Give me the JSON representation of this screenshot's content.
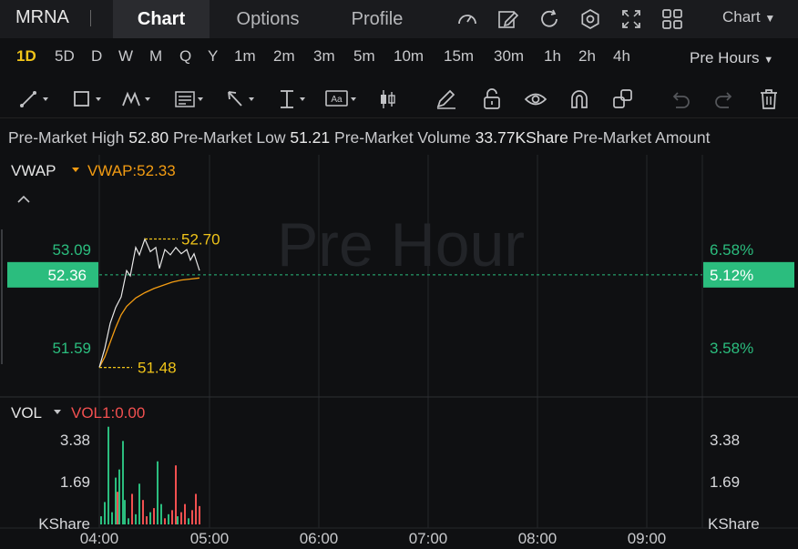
{
  "header": {
    "ticker": "MRNA",
    "tabs": [
      {
        "label": "Chart",
        "active": true
      },
      {
        "label": "Options",
        "active": false
      },
      {
        "label": "Profile",
        "active": false
      }
    ],
    "icons": [
      "gauge-icon",
      "edit-icon",
      "refresh-icon",
      "settings-icon",
      "fullscreen-icon",
      "grid-icon"
    ],
    "chart_dropdown": "Chart"
  },
  "timeframes": {
    "items": [
      "1D",
      "5D",
      "D",
      "W",
      "M",
      "Q",
      "Y",
      "1m",
      "2m",
      "3m",
      "5m",
      "10m",
      "15m",
      "30m",
      "1h",
      "2h",
      "4h"
    ],
    "active": "1D",
    "session": "Pre Hours"
  },
  "toolbar": {
    "tools": [
      "trendline-tool-icon",
      "rectangle-tool-icon",
      "pattern-tool-icon",
      "fib-tool-icon",
      "arrow-tool-icon",
      "measure-tool-icon",
      "text-tool-icon",
      "candle-tool-icon",
      "brush-icon",
      "lock-icon",
      "eye-icon",
      "magnet-icon",
      "layers-icon",
      "undo-icon",
      "redo-icon",
      "trash-icon"
    ]
  },
  "stats": {
    "high_label": "Pre-Market High",
    "high_value": "52.80",
    "low_label": "Pre-Market Low",
    "low_value": "51.21",
    "volume_label": "Pre-Market Volume",
    "volume_value": "33.77KShare",
    "amount_label": "Pre-Market Amount"
  },
  "colors": {
    "accent": "#f0c419",
    "up": "#2bbd7e",
    "down": "#f25050",
    "vwap": "#f39c12"
  },
  "chart_data": {
    "type": "line",
    "watermark": "Pre Hour",
    "indicator_label": "VWAP",
    "indicator_value_label": "VWAP:52.33",
    "price_axis_left": [
      "53.09",
      "52.36",
      "51.59"
    ],
    "price_axis_right": [
      "6.58%",
      "5.12%",
      "3.58%"
    ],
    "current_price": 52.36,
    "current_change": "5.12%",
    "ylim": [
      51.2,
      53.5
    ],
    "x_ticks": [
      "04:00",
      "05:00",
      "06:00",
      "07:00",
      "08:00",
      "09:00"
    ],
    "high_marker": {
      "label": "52.70",
      "value": 52.7
    },
    "low_marker": {
      "label": "51.48",
      "value": 51.48
    },
    "series": [
      {
        "x": [
          0,
          3,
          6,
          9,
          12,
          15,
          17,
          20,
          22,
          25,
          28,
          31,
          33,
          36,
          39,
          42,
          45,
          48,
          50,
          52,
          55
        ],
        "values": [
          51.48,
          51.66,
          51.9,
          52.05,
          52.15,
          52.4,
          52.35,
          52.62,
          52.55,
          52.7,
          52.58,
          52.62,
          52.42,
          52.6,
          52.55,
          52.62,
          52.56,
          52.6,
          52.5,
          52.56,
          52.4
        ]
      },
      {
        "name": "VWAP",
        "x": [
          0,
          3,
          6,
          9,
          12,
          15,
          20,
          25,
          30,
          35,
          40,
          45,
          50,
          55
        ],
        "values": [
          51.48,
          51.58,
          51.72,
          51.86,
          51.98,
          52.06,
          52.14,
          52.19,
          52.23,
          52.26,
          52.29,
          52.31,
          52.32,
          52.33
        ]
      }
    ],
    "volume": {
      "label": "VOL",
      "value_label": "VOL1:0.00",
      "axis_left": [
        "3.38",
        "1.69",
        "KShare"
      ],
      "axis_right": [
        "3.38",
        "1.69",
        "KShare"
      ],
      "ylim": [
        0,
        5.1
      ],
      "bars": [
        {
          "x": 1,
          "v": 0.4,
          "up": true
        },
        {
          "x": 3,
          "v": 1.1,
          "up": true
        },
        {
          "x": 5,
          "v": 4.8,
          "up": true
        },
        {
          "x": 7,
          "v": 0.6,
          "up": true
        },
        {
          "x": 9,
          "v": 2.3,
          "up": true
        },
        {
          "x": 10,
          "v": 1.6,
          "up": false
        },
        {
          "x": 11,
          "v": 2.7,
          "up": true
        },
        {
          "x": 13,
          "v": 4.1,
          "up": true
        },
        {
          "x": 14,
          "v": 1.2,
          "up": true
        },
        {
          "x": 16,
          "v": 0.3,
          "up": true
        },
        {
          "x": 18,
          "v": 1.5,
          "up": false
        },
        {
          "x": 20,
          "v": 0.5,
          "up": true
        },
        {
          "x": 22,
          "v": 2.0,
          "up": true
        },
        {
          "x": 24,
          "v": 1.2,
          "up": false
        },
        {
          "x": 26,
          "v": 0.4,
          "up": false
        },
        {
          "x": 28,
          "v": 0.6,
          "up": true
        },
        {
          "x": 30,
          "v": 0.8,
          "up": false
        },
        {
          "x": 32,
          "v": 3.1,
          "up": true
        },
        {
          "x": 34,
          "v": 1.0,
          "up": true
        },
        {
          "x": 36,
          "v": 0.3,
          "up": false
        },
        {
          "x": 38,
          "v": 0.5,
          "up": true
        },
        {
          "x": 40,
          "v": 0.7,
          "up": false
        },
        {
          "x": 42,
          "v": 2.9,
          "up": false
        },
        {
          "x": 43,
          "v": 0.4,
          "up": true
        },
        {
          "x": 45,
          "v": 0.6,
          "up": false
        },
        {
          "x": 47,
          "v": 1.0,
          "up": false
        },
        {
          "x": 49,
          "v": 0.3,
          "up": true
        },
        {
          "x": 51,
          "v": 0.7,
          "up": false
        },
        {
          "x": 53,
          "v": 1.5,
          "up": false
        },
        {
          "x": 55,
          "v": 0.9,
          "up": false
        }
      ]
    }
  }
}
